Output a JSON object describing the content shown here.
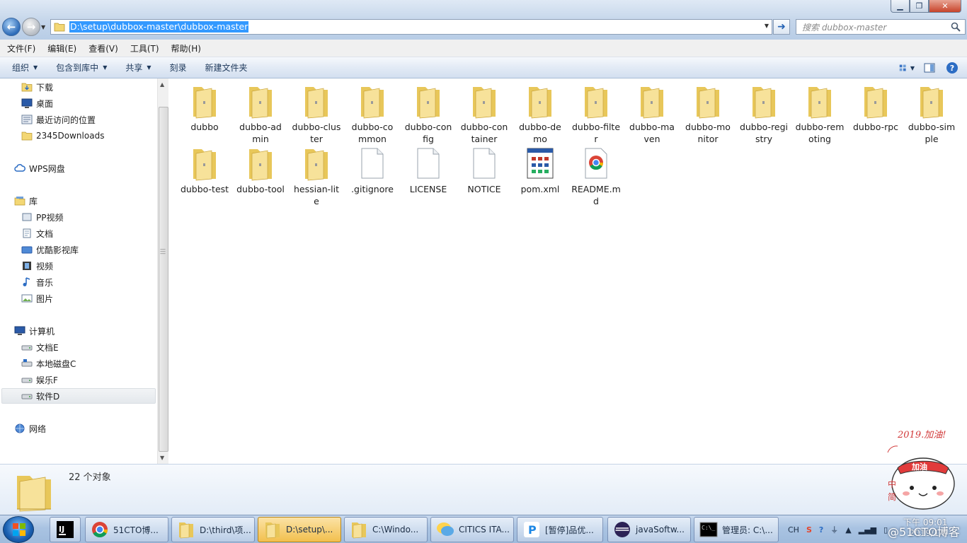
{
  "window": {
    "address_path": "D:\\setup\\dubbox-master\\dubbox-master",
    "search_placeholder": "搜索 dubbox-master"
  },
  "menu": [
    "文件(F)",
    "编辑(E)",
    "查看(V)",
    "工具(T)",
    "帮助(H)"
  ],
  "toolbar": {
    "organize": "组织",
    "include_in_library": "包含到库中",
    "share": "共享",
    "burn": "刻录",
    "new_folder": "新建文件夹"
  },
  "nav": {
    "favorites": [
      "下载",
      "桌面",
      "最近访问的位置",
      "2345Downloads"
    ],
    "wps": "WPS网盘",
    "library": "库",
    "library_items": [
      "PP视频",
      "文档",
      "优酷影视库",
      "视频",
      "音乐",
      "图片"
    ],
    "computer": "计算机",
    "drives": [
      "文档E",
      "本地磁盘C",
      "娱乐F",
      "软件D"
    ],
    "network": "网络"
  },
  "files": [
    {
      "name": "dubbo",
      "type": "folder"
    },
    {
      "name": "dubbo-admin",
      "type": "folder"
    },
    {
      "name": "dubbo-cluster",
      "type": "folder"
    },
    {
      "name": "dubbo-common",
      "type": "folder"
    },
    {
      "name": "dubbo-config",
      "type": "folder"
    },
    {
      "name": "dubbo-container",
      "type": "folder"
    },
    {
      "name": "dubbo-demo",
      "type": "folder"
    },
    {
      "name": "dubbo-filter",
      "type": "folder"
    },
    {
      "name": "dubbo-maven",
      "type": "folder"
    },
    {
      "name": "dubbo-monitor",
      "type": "folder"
    },
    {
      "name": "dubbo-registry",
      "type": "folder"
    },
    {
      "name": "dubbo-remoting",
      "type": "folder"
    },
    {
      "name": "dubbo-rpc",
      "type": "folder"
    },
    {
      "name": "dubbo-simple",
      "type": "folder"
    },
    {
      "name": "dubbo-test",
      "type": "folder"
    },
    {
      "name": "dubbo-tool",
      "type": "folder"
    },
    {
      "name": "hessian-lite",
      "type": "folder"
    },
    {
      "name": ".gitignore",
      "type": "file"
    },
    {
      "name": "LICENSE",
      "type": "file"
    },
    {
      "name": "NOTICE",
      "type": "file"
    },
    {
      "name": "pom.xml",
      "type": "xml"
    },
    {
      "name": "README.md",
      "type": "chrome"
    }
  ],
  "details": {
    "count": "22 个对象"
  },
  "sticker": {
    "text": "2019.加油!",
    "badge": "加油",
    "side_text": "中 简"
  },
  "taskbar": {
    "buttons": [
      {
        "label": "51CTO博...",
        "icon": "chrome-icon"
      },
      {
        "label": "D:\\third\\项...",
        "icon": "folder-icon"
      },
      {
        "label": "D:\\setup\\...",
        "icon": "folder-icon",
        "active": true
      },
      {
        "label": "C:\\Windo...",
        "icon": "folder-icon"
      },
      {
        "label": "CITICS ITA...",
        "icon": "chat-icon"
      },
      {
        "label": "[暂停]品优...",
        "icon": "p-icon"
      },
      {
        "label": "javaSoftw...",
        "icon": "eclipse-icon"
      },
      {
        "label": "管理员: C:\\...",
        "icon": "cmd-icon"
      }
    ],
    "tray_lang": "CH",
    "clock_time": "下午 09:01",
    "clock_date": "2019/1/6",
    "watermark": "@51CTO博客"
  },
  "colors": {
    "accent": "#3399ff",
    "folder": "#f3d774",
    "taskbar_active": "#f2bf4d"
  }
}
